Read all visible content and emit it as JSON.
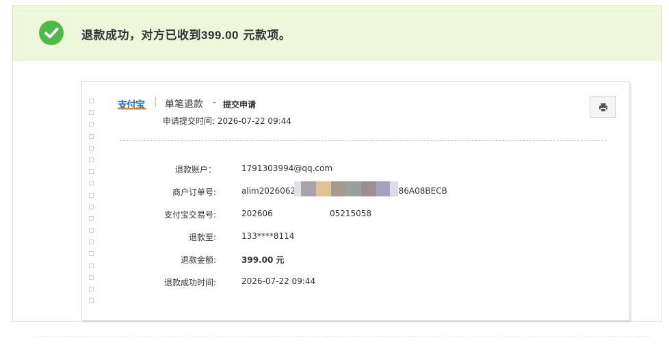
{
  "banner": {
    "prefix": "退款成功，对方已收到",
    "amount": "399.00",
    "suffix": " 元款项。"
  },
  "receipt": {
    "logo_text": "支付宝",
    "separator": "|",
    "title": "单笔退款",
    "dash": "-",
    "subtitle": "提交申请",
    "submit_time_label": "申请提交时间:",
    "submit_time": "2026-07-22 09:44",
    "rows": [
      {
        "label": "退款账户：",
        "value": "1791303994@qq.com"
      },
      {
        "label": "商户订单号:",
        "value_left": "alim20260623",
        "value_right": "086A08BECB"
      },
      {
        "label": "支付宝交易号:",
        "value_left": "202606",
        "value_right": "05215058"
      },
      {
        "label": "退款至:",
        "value": "133****8114"
      },
      {
        "label": "退款金额:",
        "value": "399.00 元"
      },
      {
        "label": "退款成功时间:",
        "value": "2026-07-22 09:44"
      }
    ]
  },
  "colors": {
    "banner_bg": "#eef7d9",
    "check_green": "#4cbb4a",
    "logo_blue": "#1a6fd0",
    "logo_orange": "#f27b24"
  },
  "icons": {
    "success": "check-circle-icon",
    "print": "printer-icon"
  }
}
